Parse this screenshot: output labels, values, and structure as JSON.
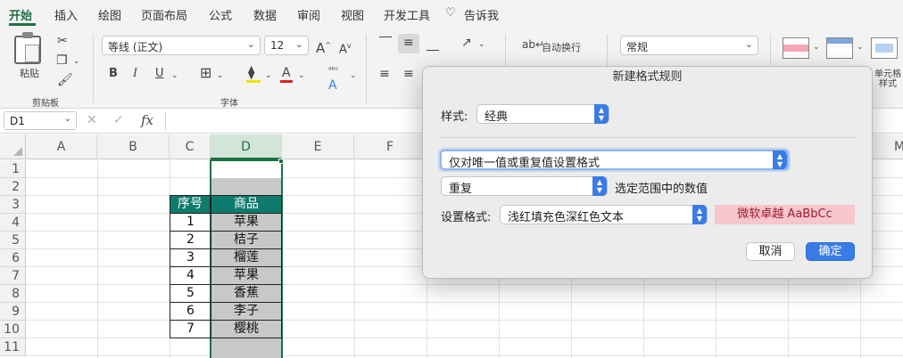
{
  "ribbon_tabs": [
    "开始",
    "插入",
    "绘图",
    "页面布局",
    "公式",
    "数据",
    "审阅",
    "视图",
    "开发工具",
    "告诉我"
  ],
  "ribbon": {
    "paste_label": "粘贴",
    "clipboard_group": "剪贴板",
    "font_name": "等线 (正文)",
    "font_size": "12",
    "font_group": "字体",
    "bold": "B",
    "italic": "I",
    "underline": "U",
    "wrap_text": "自动换行",
    "number_format": "常规",
    "cell_format_label_1": "单元格",
    "cell_format_label_2": "样式"
  },
  "formula_bar": {
    "name_box": "D1",
    "fx": "fx",
    "cancel": "✕",
    "confirm": "✓"
  },
  "columns": [
    "A",
    "B",
    "C",
    "D",
    "E",
    "F",
    "G",
    "H",
    "I",
    "J",
    "K",
    "L",
    "M"
  ],
  "rows": [
    "1",
    "2",
    "3",
    "4",
    "5",
    "6",
    "7",
    "8",
    "9",
    "10",
    "11"
  ],
  "table": {
    "headers": [
      "序号",
      "商品"
    ],
    "rows": [
      [
        "1",
        "苹果"
      ],
      [
        "2",
        "桔子"
      ],
      [
        "3",
        "榴莲"
      ],
      [
        "4",
        "苹果"
      ],
      [
        "5",
        "香蕉"
      ],
      [
        "6",
        "李子"
      ],
      [
        "7",
        "樱桃"
      ]
    ]
  },
  "dialog": {
    "title": "新建格式规则",
    "style_label": "样式:",
    "style_value": "经典",
    "rule_type": "仅对唯一值或重复值设置格式",
    "dup_value": "重复",
    "dup_suffix": "选定范围中的数值",
    "format_label": "设置格式:",
    "format_value": "浅红填充色深红色文本",
    "preview_text": "微软卓越  AaBbCc",
    "cancel": "取消",
    "ok": "确定"
  },
  "colors": {
    "accent": "#1e7145",
    "table_header": "#0f7b6c",
    "selected_column": "#c8c8c8",
    "button_blue": "#3a7ce5",
    "preview_fill": "#f7c6ce",
    "preview_text": "#9c1c2a"
  }
}
